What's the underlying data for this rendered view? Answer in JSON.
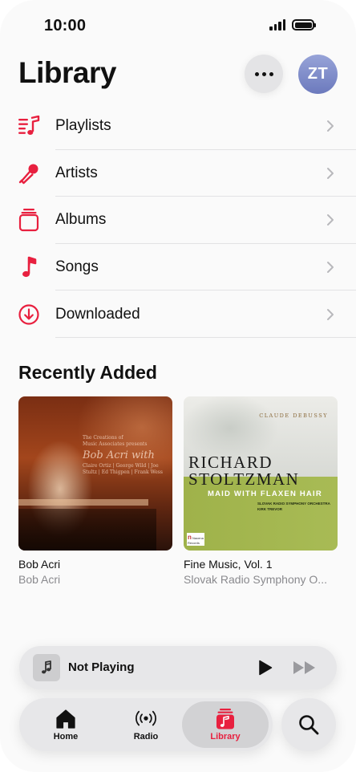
{
  "status_bar": {
    "time": "10:00"
  },
  "header": {
    "title": "Library",
    "more_icon": "ellipsis-icon",
    "avatar_initials": "ZT"
  },
  "library_items": [
    {
      "label": "Playlists",
      "icon": "playlist-icon"
    },
    {
      "label": "Artists",
      "icon": "microphone-icon"
    },
    {
      "label": "Albums",
      "icon": "album-stack-icon"
    },
    {
      "label": "Songs",
      "icon": "music-note-icon"
    },
    {
      "label": "Downloaded",
      "icon": "download-circle-icon"
    }
  ],
  "recently_added": {
    "title": "Recently Added",
    "albums": [
      {
        "title": "Bob Acri",
        "artist": "Bob Acri",
        "cover_text": {
          "small_top": "The Creations of\nMusic Associates presents",
          "big": "Bob Acri with",
          "names": "Claire Ortiz | George Wild | Joe Stultz | Ed Thigpen | Frank Wess"
        }
      },
      {
        "title": "Fine Music, Vol. 1",
        "artist": "Slovak Radio Symphony O...",
        "cover_text": {
          "composer": "CLAUDE DEBUSSY",
          "name_line1": "RICHARD",
          "name_line2": "STOLTZMAN",
          "subtitle": "MAID WITH FLAXEN HAIR",
          "orchestra": "SLOVAK RADIO SYMPHONY ORCHESTRA",
          "conductor": "KIRK TREVOR",
          "label_top": "Nacena",
          "label_bottom": "Records"
        }
      }
    ]
  },
  "mini_player": {
    "title": "Not Playing"
  },
  "tab_bar": {
    "tabs": [
      {
        "label": "Home",
        "icon": "home-icon",
        "active": false
      },
      {
        "label": "Radio",
        "icon": "radio-icon",
        "active": false
      },
      {
        "label": "Library",
        "icon": "library-icon",
        "active": true
      }
    ],
    "search_icon": "search-icon"
  },
  "colors": {
    "accent": "#e8203f",
    "background": "#fafafa",
    "control_bg": "#e7e7e9",
    "secondary_text": "#8a8a8e"
  }
}
